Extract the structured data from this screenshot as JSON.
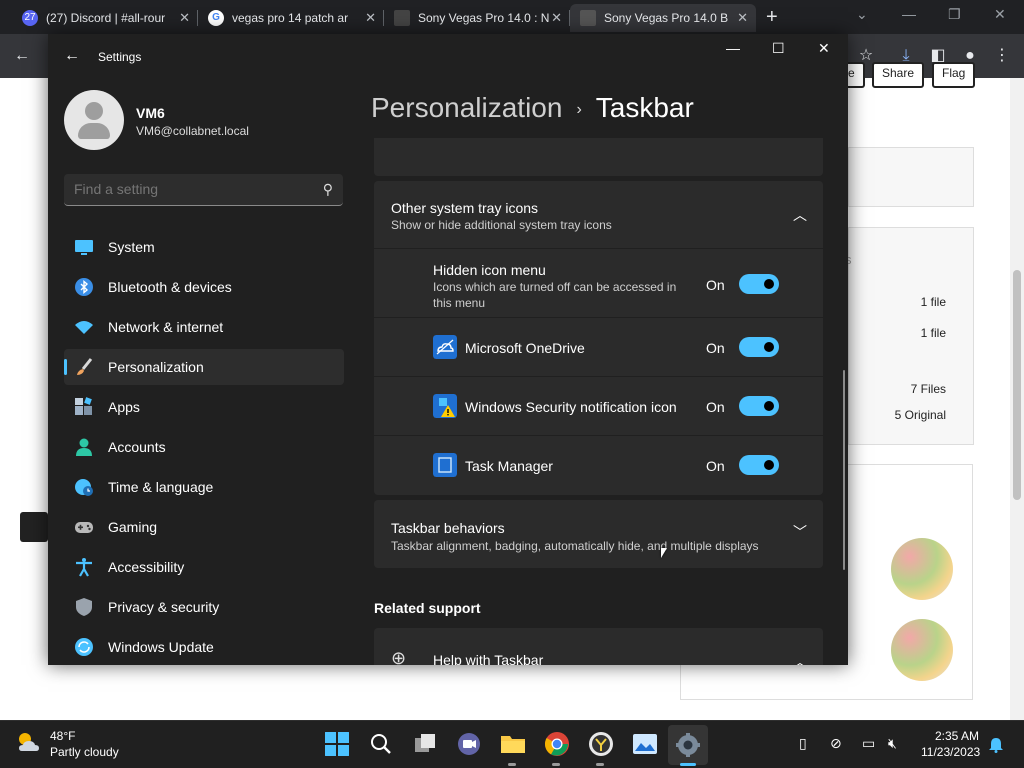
{
  "browser": {
    "tabs": [
      {
        "label": "(27) Discord | #all-rour",
        "badge": "27"
      },
      {
        "label": "vegas pro 14 patch ar",
        "badge": "G"
      },
      {
        "label": "Sony Vegas Pro 14.0 : N",
        "badge": ""
      },
      {
        "label": "Sony Vegas Pro 14.0 B",
        "badge": ""
      }
    ],
    "new_tab_symbol": "+",
    "page": {
      "buttons": [
        "e",
        "Share",
        "Flag"
      ],
      "rows": [
        "1 file",
        "1 file",
        "7 Files",
        "5 Original"
      ],
      "partial_letter": "s"
    }
  },
  "settings": {
    "app_title": "Settings",
    "user": {
      "name": "VM6",
      "email": "VM6@collabnet.local"
    },
    "search": {
      "placeholder": "Find a setting"
    },
    "nav": [
      {
        "label": "System",
        "icon": "monitor-icon",
        "color": "#4cc2ff"
      },
      {
        "label": "Bluetooth & devices",
        "icon": "bluetooth-icon",
        "color": "#3a8ee6"
      },
      {
        "label": "Network & internet",
        "icon": "wifi-icon",
        "color": "#4cc2ff"
      },
      {
        "label": "Personalization",
        "icon": "brush-icon",
        "color": "#f0a35e",
        "active": true
      },
      {
        "label": "Apps",
        "icon": "apps-icon",
        "color": "#9fb3c8"
      },
      {
        "label": "Accounts",
        "icon": "person-icon",
        "color": "#2dc7a5"
      },
      {
        "label": "Time & language",
        "icon": "globe-clock-icon",
        "color": "#4cc2ff"
      },
      {
        "label": "Gaming",
        "icon": "gamepad-icon",
        "color": "#b9b9b9"
      },
      {
        "label": "Accessibility",
        "icon": "accessibility-icon",
        "color": "#4cc2ff"
      },
      {
        "label": "Privacy & security",
        "icon": "shield-icon",
        "color": "#9aa3ad"
      },
      {
        "label": "Windows Update",
        "icon": "update-icon",
        "color": "#4cc2ff"
      }
    ],
    "breadcrumb": {
      "parent": "Personalization",
      "separator": "›",
      "current": "Taskbar"
    },
    "tray_section": {
      "title": "Other system tray icons",
      "subtitle": "Show or hide additional system tray icons",
      "expanded": true,
      "items": [
        {
          "label": "Hidden icon menu",
          "description": "Icons which are turned off can be accessed in this menu",
          "state": "On",
          "on": true
        },
        {
          "label": "Microsoft OneDrive",
          "icon": "onedrive-icon",
          "state": "On",
          "on": true
        },
        {
          "label": "Windows Security notification icon",
          "icon": "security-warning-icon",
          "state": "On",
          "on": true
        },
        {
          "label": "Task Manager",
          "icon": "task-manager-icon",
          "state": "On",
          "on": true
        }
      ]
    },
    "behaviors_section": {
      "title": "Taskbar behaviors",
      "subtitle": "Taskbar alignment, badging, automatically hide, and multiple displays",
      "expanded": false
    },
    "related_support": {
      "heading": "Related support",
      "item": "Help with Taskbar"
    }
  },
  "taskbar": {
    "weather": {
      "temp": "48°F",
      "desc": "Partly cloudy"
    },
    "apps": [
      "start-icon",
      "search-icon",
      "task-view-icon",
      "teams-chat-icon",
      "file-explorer-icon",
      "chrome-icon",
      "app-icon",
      "photos-icon",
      "settings-icon"
    ],
    "clock": {
      "time": "2:35 AM",
      "date": "11/23/2023"
    }
  },
  "colors": {
    "accent": "#4cc2ff",
    "window_bg": "#202020",
    "card_bg": "#2b2b2b"
  }
}
